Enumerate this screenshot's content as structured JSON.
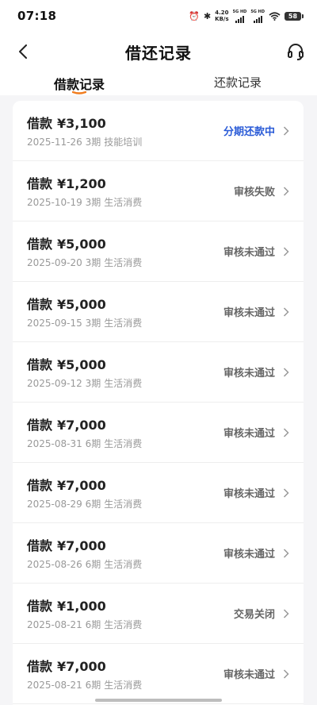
{
  "status_bar": {
    "time": "07:18",
    "net_speed_value": "4.20",
    "net_speed_unit": "KB/s",
    "sim1": "5G HD",
    "sim2": "5G HD",
    "battery": "58"
  },
  "header": {
    "title": "借还记录",
    "back_icon": "chevron-left-icon",
    "service_icon": "headset-icon"
  },
  "tabs": [
    {
      "label": "借款记录",
      "active": true
    },
    {
      "label": "还款记录",
      "active": false
    }
  ],
  "colors": {
    "accent_orange": "#f07c1e",
    "status_blue": "#2a5bd7",
    "status_gray": "#666666"
  },
  "records": [
    {
      "label": "借款",
      "amount": "¥3,100",
      "date": "2025-11-26",
      "term": "3期",
      "purpose": "技能培训",
      "status": "分期还款中"
    },
    {
      "label": "借款",
      "amount": "¥1,200",
      "date": "2025-10-19",
      "term": "3期",
      "purpose": "生活消费",
      "status": "审核失败"
    },
    {
      "label": "借款",
      "amount": "¥5,000",
      "date": "2025-09-20",
      "term": "3期",
      "purpose": "生活消费",
      "status": "审核未通过"
    },
    {
      "label": "借款",
      "amount": "¥5,000",
      "date": "2025-09-15",
      "term": "3期",
      "purpose": "生活消费",
      "status": "审核未通过"
    },
    {
      "label": "借款",
      "amount": "¥5,000",
      "date": "2025-09-12",
      "term": "3期",
      "purpose": "生活消费",
      "status": "审核未通过"
    },
    {
      "label": "借款",
      "amount": "¥7,000",
      "date": "2025-08-31",
      "term": "6期",
      "purpose": "生活消费",
      "status": "审核未通过"
    },
    {
      "label": "借款",
      "amount": "¥7,000",
      "date": "2025-08-29",
      "term": "6期",
      "purpose": "生活消费",
      "status": "审核未通过"
    },
    {
      "label": "借款",
      "amount": "¥7,000",
      "date": "2025-08-26",
      "term": "6期",
      "purpose": "生活消费",
      "status": "审核未通过"
    },
    {
      "label": "借款",
      "amount": "¥1,000",
      "date": "2025-08-21",
      "term": "6期",
      "purpose": "生活消费",
      "status": "交易关闭"
    },
    {
      "label": "借款",
      "amount": "¥7,000",
      "date": "2025-08-21",
      "term": "6期",
      "purpose": "生活消费",
      "status": "审核未通过"
    }
  ]
}
